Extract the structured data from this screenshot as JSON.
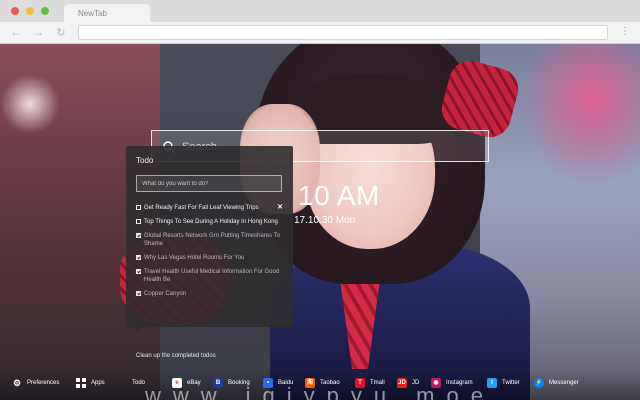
{
  "browser": {
    "tab_title": "NewTab"
  },
  "search": {
    "placeholder": "Search"
  },
  "clock": {
    "time": "10 AM",
    "date": "17.10.30 Mon"
  },
  "todo": {
    "title": "Todo",
    "input_placeholder": "What do you want to do?",
    "items": [
      {
        "text": "Get Ready Fast For Fall Leaf Viewing Trips",
        "done": false
      },
      {
        "text": "Top Things To See During A Holiday In Hong Kong",
        "done": false
      },
      {
        "text": "Global Resorts Network Grn Putting Timeshares To Shame",
        "done": true
      },
      {
        "text": "Why Las Vegas Hotel Rooms For You",
        "done": true
      },
      {
        "text": "Travel Health Useful Medical Information For Good Health Be",
        "done": true
      },
      {
        "text": "Copper Canyon",
        "done": true
      }
    ],
    "clean_label": "Clean up the completed todos"
  },
  "bottom_bar": {
    "items": [
      {
        "label": "Preferences",
        "icon": "gear-icon",
        "color": "#ffffff"
      },
      {
        "label": "Apps",
        "icon": "apps-grid-icon",
        "color": "#ffffff"
      },
      {
        "label": "Todo",
        "icon": "todo-icon",
        "color": "#ffffff"
      },
      {
        "label": "eBay",
        "icon": "ebay-icon",
        "color": "#ffffff"
      },
      {
        "label": "Booking",
        "icon": "booking-icon",
        "color": "#1c3f94"
      },
      {
        "label": "Baidu",
        "icon": "baidu-icon",
        "color": "#2a6cf0"
      },
      {
        "label": "Taobao",
        "icon": "taobao-icon",
        "color": "#ff5a00"
      },
      {
        "label": "Tmall",
        "icon": "tmall-icon",
        "color": "#e0102a"
      },
      {
        "label": "JD",
        "icon": "jd-icon",
        "color": "#e1251b"
      },
      {
        "label": "Instagram",
        "icon": "instagram-icon",
        "color": "#c2185b"
      },
      {
        "label": "Twitter",
        "icon": "twitter-icon",
        "color": "#1da1f2"
      },
      {
        "label": "Messenger",
        "icon": "messenger-icon",
        "color": "#0084ff"
      }
    ],
    "watermark": "www.iqiypyu.moe"
  }
}
